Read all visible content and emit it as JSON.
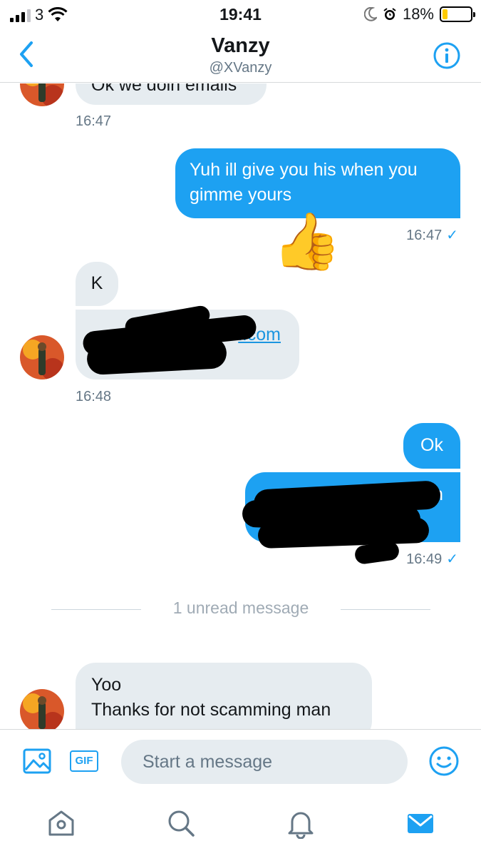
{
  "status_bar": {
    "carrier": "3",
    "time": "19:41",
    "battery_percent": "18%",
    "battery_level": 0.18,
    "icons": [
      "signal-icon",
      "wifi-icon",
      "moon-icon",
      "alarm-icon",
      "battery-icon"
    ]
  },
  "header": {
    "name": "Vanzy",
    "handle": "@XVanzy",
    "icons": [
      "back-chevron-icon",
      "info-icon"
    ]
  },
  "messages": {
    "m1": {
      "direction": "in",
      "text": "Ok we doin emails",
      "time": "16:47"
    },
    "m2": {
      "direction": "out",
      "text": "Yuh ill give you his when you gimme yours",
      "time": "16:47",
      "emoji": "👍"
    },
    "m3": {
      "direction": "in",
      "text": "K"
    },
    "m4": {
      "direction": "in",
      "link_visible_text": "l.com",
      "time": "16:48"
    },
    "m5": {
      "direction": "out",
      "text": "Ok"
    },
    "m6": {
      "direction": "out",
      "text": "m",
      "time": "16:49"
    },
    "m7": {
      "direction": "in",
      "line1": "Yoo",
      "line2": "Thanks for not scamming man"
    }
  },
  "unread_divider": "1 unread message",
  "composer": {
    "placeholder": "Start a message",
    "gif_label": "GIF",
    "icons": [
      "image-icon",
      "gif-icon",
      "emoji-icon"
    ]
  },
  "tabbar": {
    "icons": [
      "home-icon",
      "search-icon",
      "notifications-icon",
      "messages-icon"
    ],
    "active": "messages-icon"
  },
  "colors": {
    "accent": "#1da1f2",
    "incoming_bubble": "#e6ecf0",
    "secondary_text": "#657786",
    "battery_low": "#ffcc00"
  }
}
